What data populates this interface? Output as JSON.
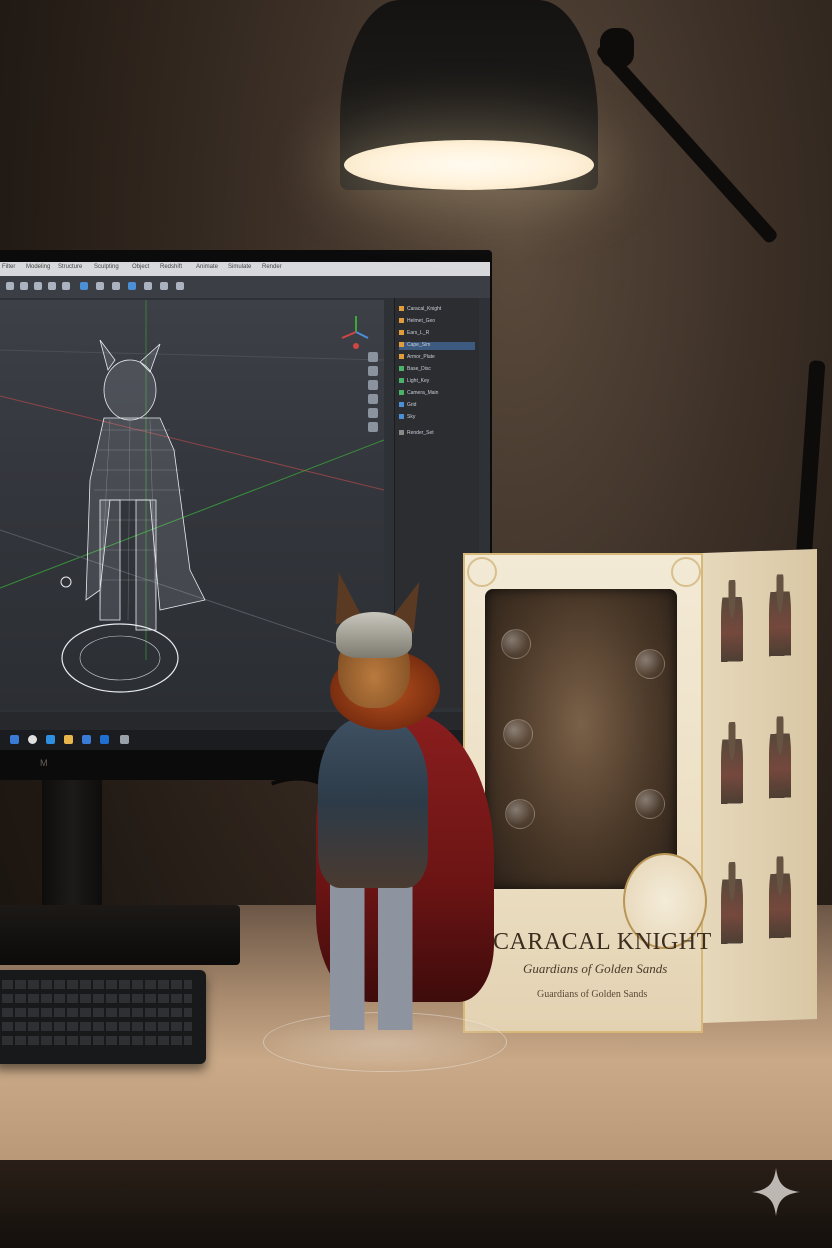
{
  "monitor": {
    "brand": "M",
    "menu": [
      "Filter",
      "Modeling",
      "Structure",
      "Sculpting",
      "Object",
      "Redshift",
      "Animate",
      "Simulate",
      "Render"
    ],
    "outliner_items": [
      "Caracal_Knight",
      "Helmet_Geo",
      "Ears_L_R",
      "Cape_Sim",
      "Armor_Plate",
      "Base_Disc",
      "Light_Key",
      "Camera_Main",
      "Grid",
      "Sky",
      "Render_Set"
    ]
  },
  "box": {
    "title": "CARACAL KNIGHT",
    "subtitle": "Guardians of Golden Sands",
    "footer": "Guardians of Golden Sands"
  },
  "colors": {
    "box_gold": "#c6a45e",
    "cape_red": "#8a1e1e",
    "wire_white": "#e8ecf2",
    "grid_green": "#3aa83a",
    "grid_red": "#b34040"
  },
  "icons": [
    "lamp-icon",
    "sparkle-icon"
  ]
}
